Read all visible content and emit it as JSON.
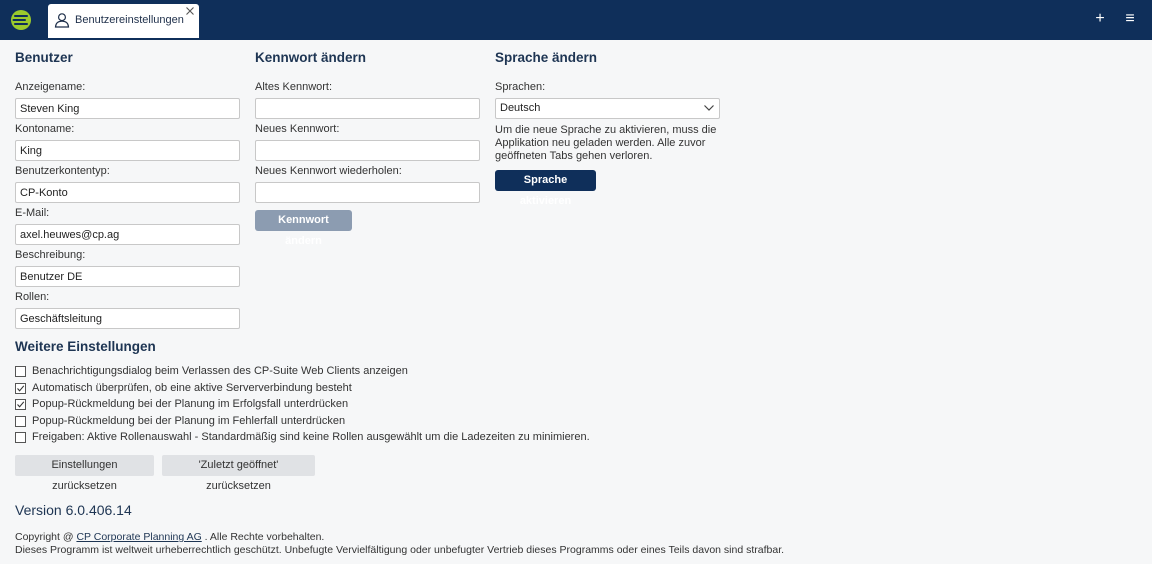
{
  "header": {
    "logo_icon": "cp-logo-icon",
    "tab": {
      "label": "Benutzereinstellungen",
      "icon": "user-icon",
      "close_icon": "close-icon"
    },
    "add_icon_glyph": "+",
    "menu_icon_glyph": "≡"
  },
  "user": {
    "title": "Benutzer",
    "fields": [
      {
        "label": "Anzeigename:",
        "value": "Steven King"
      },
      {
        "label": "Kontoname:",
        "value": "King"
      },
      {
        "label": "Benutzerkontentyp:",
        "value": "CP-Konto"
      },
      {
        "label": "E-Mail:",
        "value": "axel.heuwes@cp.ag"
      },
      {
        "label": "Beschreibung:",
        "value": "Benutzer DE"
      },
      {
        "label": "Rollen:",
        "value": "Geschäftsleitung"
      }
    ]
  },
  "password": {
    "title": "Kennwort ändern",
    "old_label": "Altes Kennwort:",
    "new_label": "Neues Kennwort:",
    "repeat_label": "Neues Kennwort wiederholen:",
    "button_label": "Kennwort ändern"
  },
  "language": {
    "title": "Sprache ändern",
    "select_label": "Sprachen:",
    "selected": "Deutsch",
    "info": "Um die neue Sprache zu aktivieren, muss die Applikation neu geladen werden. Alle zuvor geöffneten Tabs gehen verloren.",
    "button_label": "Sprache aktivieren"
  },
  "further": {
    "title": "Weitere Einstellungen",
    "options": [
      {
        "label": "Benachrichtigungsdialog beim Verlassen des CP-Suite Web Clients anzeigen",
        "checked": false
      },
      {
        "label": "Automatisch überprüfen, ob eine aktive Serververbindung besteht",
        "checked": true
      },
      {
        "label": "Popup-Rückmeldung bei der Planung im Erfolgsfall unterdrücken",
        "checked": true
      },
      {
        "label": "Popup-Rückmeldung bei der Planung im Fehlerfall unterdrücken",
        "checked": false
      },
      {
        "label": "Freigaben: Aktive Rollenauswahl - Standardmäßig sind keine Rollen ausgewählt um die Ladezeiten zu minimieren.",
        "checked": false
      }
    ],
    "reset_settings_label": "Einstellungen zurücksetzen",
    "reset_recent_label": "'Zuletzt geöffnet' zurücksetzen"
  },
  "footer": {
    "version": "Version 6.0.406.14",
    "copyright_prefix": "Copyright @",
    "company_link": "CP Corporate Planning AG",
    "copyright_suffix": ". Alle Rechte vorbehalten.",
    "legal": "Dieses Programm ist weltweit urheberrechtlich geschützt. Unbefugte Vervielfältigung oder unbefugter Vertrieb dieses Programms oder eines Teils davon sind strafbar."
  },
  "colors": {
    "header_bg": "#0f2f5a",
    "logo_green": "#9ccb2c",
    "primary_button": "#0f2f5a",
    "disabled_button": "#8c9cb1"
  }
}
